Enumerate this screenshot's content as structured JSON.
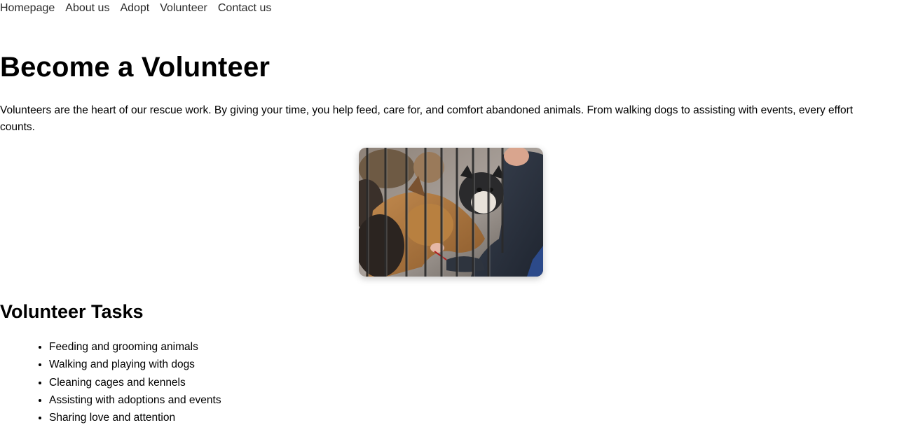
{
  "nav": {
    "items": [
      {
        "label": "Homepage"
      },
      {
        "label": "About us"
      },
      {
        "label": "Adopt"
      },
      {
        "label": "Volunteer"
      },
      {
        "label": "Contact us"
      }
    ]
  },
  "page": {
    "title": "Become a Volunteer",
    "intro": "Volunteers are the heart of our rescue work. By giving your time, you help feed, care for, and comfort abandoned animals. From walking dogs to assisting with events, every effort counts."
  },
  "tasks": {
    "title": "Volunteer Tasks",
    "items": [
      "Feeding and grooming animals",
      "Walking and playing with dogs",
      "Cleaning cages and kennels",
      "Assisting with adoptions and events",
      "Sharing love and attention"
    ]
  }
}
